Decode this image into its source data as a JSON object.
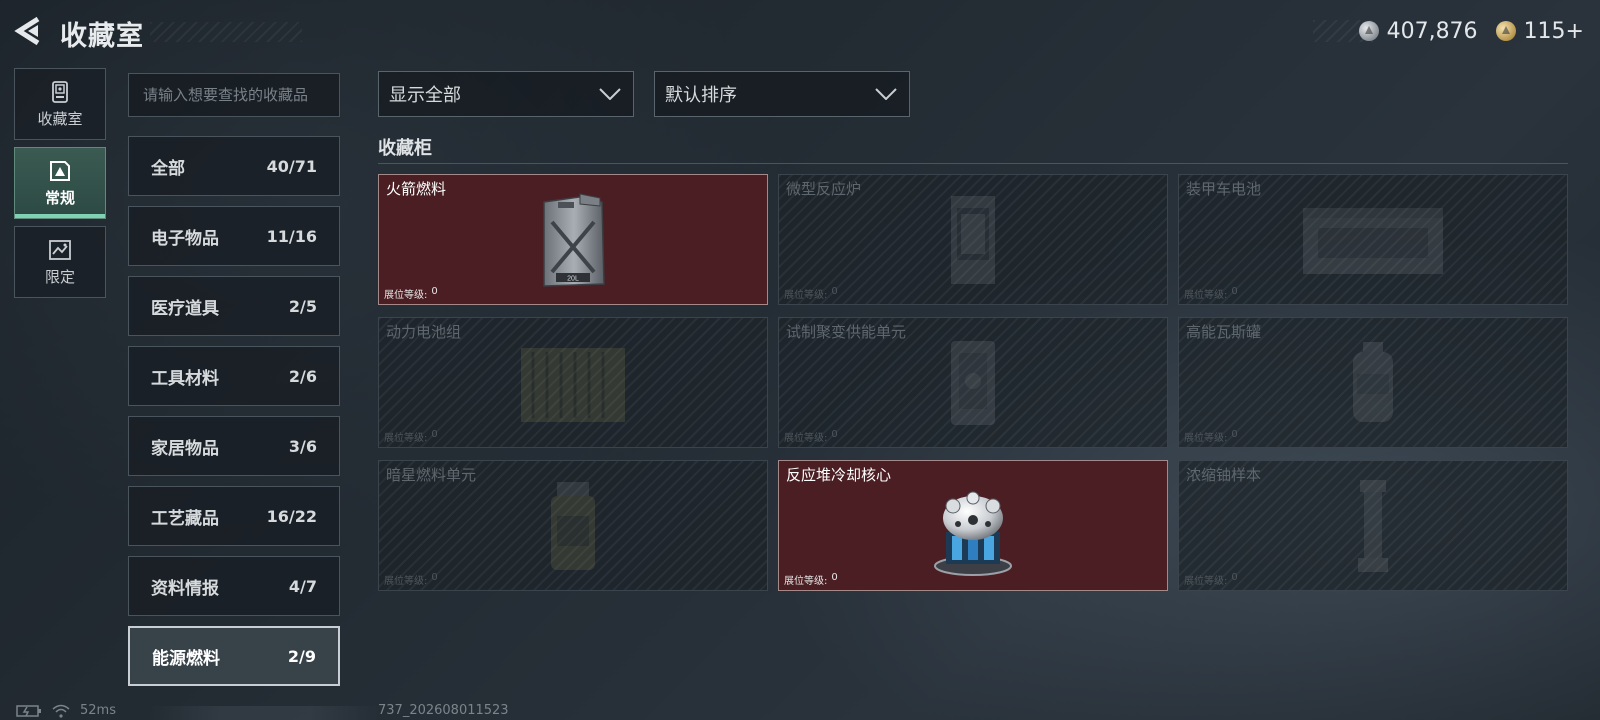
{
  "header": {
    "title": "收藏室",
    "currency": [
      {
        "icon": "silver-coin-icon",
        "value": "407,876"
      },
      {
        "icon": "gold-coin-icon",
        "value": "115+"
      }
    ]
  },
  "leftnav": {
    "items": [
      {
        "label": "收藏室",
        "icon": "collection-room-icon",
        "active": false
      },
      {
        "label": "常规",
        "icon": "regular-icon",
        "active": true
      },
      {
        "label": "限定",
        "icon": "limited-icon",
        "active": false
      }
    ]
  },
  "search": {
    "placeholder": "请输入想要查找的收藏品"
  },
  "categories": [
    {
      "name": "全部",
      "count": "40/71"
    },
    {
      "name": "电子物品",
      "count": "11/16"
    },
    {
      "name": "医疗道具",
      "count": "2/5"
    },
    {
      "name": "工具材料",
      "count": "2/6"
    },
    {
      "name": "家居物品",
      "count": "3/6"
    },
    {
      "name": "工艺藏品",
      "count": "16/22"
    },
    {
      "name": "资料情报",
      "count": "4/7"
    },
    {
      "name": "能源燃料",
      "count": "2/9",
      "active": true
    }
  ],
  "filters": {
    "display": "显示全部",
    "sort": "默认排序"
  },
  "section_title": "收藏柜",
  "items": [
    {
      "name": "火箭燃料",
      "level_label": "展位等级:",
      "level": "0",
      "unlocked": true,
      "icon": "jerrycan-icon",
      "can_label": "20L"
    },
    {
      "name": "微型反应炉",
      "level_label": "展位等级:",
      "level": "0",
      "unlocked": false,
      "icon": "reactor-icon"
    },
    {
      "name": "装甲车电池",
      "level_label": "展位等级:",
      "level": "0",
      "unlocked": false,
      "icon": "battery-pack-icon"
    },
    {
      "name": "动力电池组",
      "level_label": "展位等级:",
      "level": "0",
      "unlocked": false,
      "icon": "power-cell-icon"
    },
    {
      "name": "试制聚变供能单元",
      "level_label": "展位等级:",
      "level": "0",
      "unlocked": false,
      "icon": "fusion-unit-icon"
    },
    {
      "name": "高能瓦斯罐",
      "level_label": "展位等级:",
      "level": "0",
      "unlocked": false,
      "icon": "gas-canister-icon"
    },
    {
      "name": "暗星燃料单元",
      "level_label": "展位等级:",
      "level": "0",
      "unlocked": false,
      "icon": "fuel-unit-icon"
    },
    {
      "name": "反应堆冷却核心",
      "level_label": "展位等级:",
      "level": "0",
      "unlocked": true,
      "icon": "cooling-core-icon"
    },
    {
      "name": "浓缩铀样本",
      "level_label": "展位等级:",
      "level": "0",
      "unlocked": false,
      "icon": "uranium-sample-icon"
    }
  ],
  "status": {
    "ping": "52ms",
    "build": "737_202608011523"
  },
  "colors": {
    "unlocked_card": "#4a1e22",
    "active_nav": "#2c4a43",
    "active_nav_accent": "#7fd3b2"
  }
}
